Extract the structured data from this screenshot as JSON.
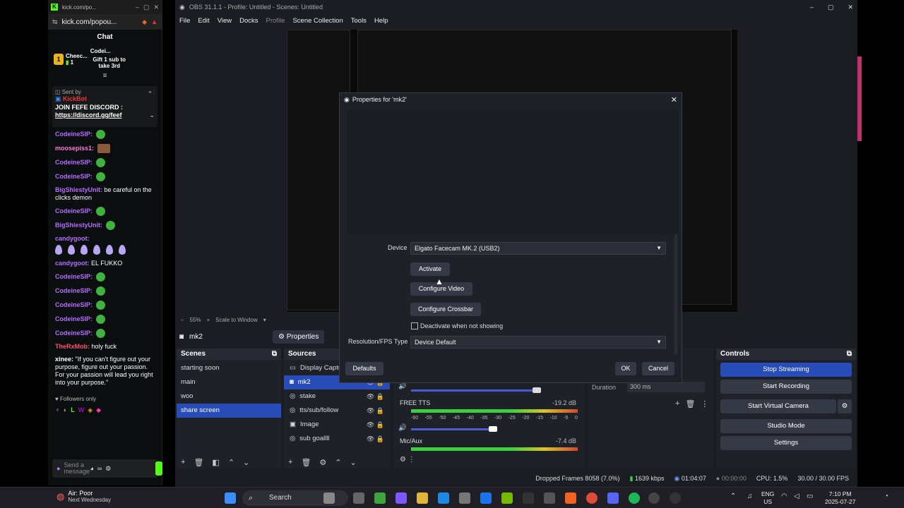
{
  "browser": {
    "tab_title": "kick.com/po...",
    "url": "kick.com/popou...",
    "chat_title": "Chat",
    "gifters": [
      {
        "rank": "1",
        "name": "Cheec...",
        "count": "1"
      },
      {
        "name": "Codei...",
        "note": "Gift 1 sub to take 3rd"
      }
    ],
    "pinned": {
      "sent_by": "Sent by",
      "user": "KickBot",
      "text": "JOIN FEFE DISCORD :",
      "link": "https://discord.gg/feef"
    },
    "messages": [
      {
        "user": "CodeineSIP:",
        "color": "#b56cff",
        "text": ""
      },
      {
        "user": "moosepiss1:",
        "color": "#ff7ad9",
        "text": ""
      },
      {
        "user": "CodeineSIP:",
        "color": "#b56cff",
        "text": ""
      },
      {
        "user": "CodeineSIP:",
        "color": "#b56cff",
        "text": ""
      },
      {
        "user": "BigShiestyUnit:",
        "color": "#b56cff",
        "text": "be careful on the clicks demon"
      },
      {
        "user": "CodeineSIP:",
        "color": "#b56cff",
        "text": ""
      },
      {
        "user": "BigShiestyUnit:",
        "color": "#b56cff",
        "text": ""
      },
      {
        "user": "candygoot:",
        "color": "#b56cff",
        "text": ""
      },
      {
        "user": "candygoot:",
        "color": "#b56cff",
        "text": "EL FUKKO"
      },
      {
        "user": "CodeineSIP:",
        "color": "#b56cff",
        "text": ""
      },
      {
        "user": "CodeineSIP:",
        "color": "#b56cff",
        "text": ""
      },
      {
        "user": "CodeineSIP:",
        "color": "#b56cff",
        "text": ""
      },
      {
        "user": "CodeineSIP:",
        "color": "#b56cff",
        "text": ""
      },
      {
        "user": "CodeineSIP:",
        "color": "#b56cff",
        "text": ""
      },
      {
        "user": "TheRxMob:",
        "color": "#ff4d6d",
        "text": "holy fuck"
      },
      {
        "user": "xinee:",
        "color": "#ffffff",
        "text": "\"If you can't figure out your purpose, figure out your passion. For your passion will lead you right into your purpose.\""
      }
    ],
    "followers_only": "Followers only",
    "input_placeholder": "Send a message"
  },
  "obs": {
    "title": "OBS 31.1.1 - Profile: Untitled - Scenes: Untitled",
    "menu": [
      "File",
      "Edit",
      "View",
      "Docks",
      "Profile",
      "Scene Collection",
      "Tools",
      "Help"
    ],
    "zoom": "55%",
    "scale_label": "Scale to Window",
    "selected_source": "mk2",
    "properties_btn": "Properties",
    "scenes_title": "Scenes",
    "scenes": [
      "starting soon",
      "main",
      "woo",
      "share screen"
    ],
    "sources_title": "Sources",
    "sources": [
      "Display Captu",
      "mk2",
      "stake",
      "tts/sub/follow",
      "Image",
      "sub goallll"
    ],
    "audio": [
      {
        "name": "FREE TTS",
        "db": "-19.2 dB"
      },
      {
        "name": "Mic/Aux",
        "db": "-7.4 dB"
      }
    ],
    "meter_ticks": [
      "-60",
      "-55",
      "-50",
      "-45",
      "-40",
      "-35",
      "-30",
      "-25",
      "-20",
      "-15",
      "-10",
      "-5",
      "0"
    ],
    "transition": {
      "duration_label": "Duration",
      "duration_value": "300 ms"
    },
    "controls_title": "Controls",
    "controls": [
      "Stop Streaming",
      "Start Recording",
      "Start Virtual Camera",
      "Studio Mode",
      "Settings"
    ],
    "status": {
      "dropped": "Dropped Frames 8058 (7.0%)",
      "kbps": "1639 kbps",
      "live": "01:04:07",
      "rec": "00:00:00",
      "cpu": "CPU: 1.5%",
      "fps": "30.00 / 30.00 FPS"
    }
  },
  "props": {
    "title": "Properties for 'mk2'",
    "device_label": "Device",
    "device_value": "Elgato Facecam MK.2 (USB2)",
    "activate": "Activate",
    "configure_video": "Configure Video",
    "configure_crossbar": "Configure Crossbar",
    "deactivate_label": "Deactivate when not showing",
    "resfps_label": "Resolution/FPS Type",
    "resfps_value": "Device Default",
    "defaults": "Defaults",
    "ok": "OK",
    "cancel": "Cancel"
  },
  "taskbar": {
    "weather_title": "Air: Poor",
    "weather_sub": "Next Wednesday",
    "search": "Search",
    "lang1": "ENG",
    "lang2": "US",
    "time": "7:10 PM",
    "date": "2025-07-27"
  }
}
